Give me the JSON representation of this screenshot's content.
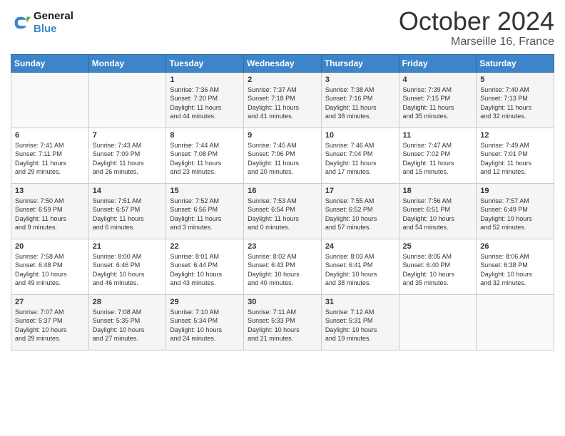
{
  "logo": {
    "text_general": "General",
    "text_blue": "Blue"
  },
  "title": "October 2024",
  "subtitle": "Marseille 16, France",
  "days_header": [
    "Sunday",
    "Monday",
    "Tuesday",
    "Wednesday",
    "Thursday",
    "Friday",
    "Saturday"
  ],
  "weeks": [
    [
      {
        "day": "",
        "info": ""
      },
      {
        "day": "",
        "info": ""
      },
      {
        "day": "1",
        "info": "Sunrise: 7:36 AM\nSunset: 7:20 PM\nDaylight: 11 hours\nand 44 minutes."
      },
      {
        "day": "2",
        "info": "Sunrise: 7:37 AM\nSunset: 7:18 PM\nDaylight: 11 hours\nand 41 minutes."
      },
      {
        "day": "3",
        "info": "Sunrise: 7:38 AM\nSunset: 7:16 PM\nDaylight: 11 hours\nand 38 minutes."
      },
      {
        "day": "4",
        "info": "Sunrise: 7:39 AM\nSunset: 7:15 PM\nDaylight: 11 hours\nand 35 minutes."
      },
      {
        "day": "5",
        "info": "Sunrise: 7:40 AM\nSunset: 7:13 PM\nDaylight: 11 hours\nand 32 minutes."
      }
    ],
    [
      {
        "day": "6",
        "info": "Sunrise: 7:41 AM\nSunset: 7:11 PM\nDaylight: 11 hours\nand 29 minutes."
      },
      {
        "day": "7",
        "info": "Sunrise: 7:43 AM\nSunset: 7:09 PM\nDaylight: 11 hours\nand 26 minutes."
      },
      {
        "day": "8",
        "info": "Sunrise: 7:44 AM\nSunset: 7:08 PM\nDaylight: 11 hours\nand 23 minutes."
      },
      {
        "day": "9",
        "info": "Sunrise: 7:45 AM\nSunset: 7:06 PM\nDaylight: 11 hours\nand 20 minutes."
      },
      {
        "day": "10",
        "info": "Sunrise: 7:46 AM\nSunset: 7:04 PM\nDaylight: 11 hours\nand 17 minutes."
      },
      {
        "day": "11",
        "info": "Sunrise: 7:47 AM\nSunset: 7:02 PM\nDaylight: 11 hours\nand 15 minutes."
      },
      {
        "day": "12",
        "info": "Sunrise: 7:49 AM\nSunset: 7:01 PM\nDaylight: 11 hours\nand 12 minutes."
      }
    ],
    [
      {
        "day": "13",
        "info": "Sunrise: 7:50 AM\nSunset: 6:59 PM\nDaylight: 11 hours\nand 9 minutes."
      },
      {
        "day": "14",
        "info": "Sunrise: 7:51 AM\nSunset: 6:57 PM\nDaylight: 11 hours\nand 6 minutes."
      },
      {
        "day": "15",
        "info": "Sunrise: 7:52 AM\nSunset: 6:56 PM\nDaylight: 11 hours\nand 3 minutes."
      },
      {
        "day": "16",
        "info": "Sunrise: 7:53 AM\nSunset: 6:54 PM\nDaylight: 11 hours\nand 0 minutes."
      },
      {
        "day": "17",
        "info": "Sunrise: 7:55 AM\nSunset: 6:52 PM\nDaylight: 10 hours\nand 57 minutes."
      },
      {
        "day": "18",
        "info": "Sunrise: 7:56 AM\nSunset: 6:51 PM\nDaylight: 10 hours\nand 54 minutes."
      },
      {
        "day": "19",
        "info": "Sunrise: 7:57 AM\nSunset: 6:49 PM\nDaylight: 10 hours\nand 52 minutes."
      }
    ],
    [
      {
        "day": "20",
        "info": "Sunrise: 7:58 AM\nSunset: 6:48 PM\nDaylight: 10 hours\nand 49 minutes."
      },
      {
        "day": "21",
        "info": "Sunrise: 8:00 AM\nSunset: 6:46 PM\nDaylight: 10 hours\nand 46 minutes."
      },
      {
        "day": "22",
        "info": "Sunrise: 8:01 AM\nSunset: 6:44 PM\nDaylight: 10 hours\nand 43 minutes."
      },
      {
        "day": "23",
        "info": "Sunrise: 8:02 AM\nSunset: 6:43 PM\nDaylight: 10 hours\nand 40 minutes."
      },
      {
        "day": "24",
        "info": "Sunrise: 8:03 AM\nSunset: 6:41 PM\nDaylight: 10 hours\nand 38 minutes."
      },
      {
        "day": "25",
        "info": "Sunrise: 8:05 AM\nSunset: 6:40 PM\nDaylight: 10 hours\nand 35 minutes."
      },
      {
        "day": "26",
        "info": "Sunrise: 8:06 AM\nSunset: 6:38 PM\nDaylight: 10 hours\nand 32 minutes."
      }
    ],
    [
      {
        "day": "27",
        "info": "Sunrise: 7:07 AM\nSunset: 5:37 PM\nDaylight: 10 hours\nand 29 minutes."
      },
      {
        "day": "28",
        "info": "Sunrise: 7:08 AM\nSunset: 5:35 PM\nDaylight: 10 hours\nand 27 minutes."
      },
      {
        "day": "29",
        "info": "Sunrise: 7:10 AM\nSunset: 5:34 PM\nDaylight: 10 hours\nand 24 minutes."
      },
      {
        "day": "30",
        "info": "Sunrise: 7:11 AM\nSunset: 5:33 PM\nDaylight: 10 hours\nand 21 minutes."
      },
      {
        "day": "31",
        "info": "Sunrise: 7:12 AM\nSunset: 5:31 PM\nDaylight: 10 hours\nand 19 minutes."
      },
      {
        "day": "",
        "info": ""
      },
      {
        "day": "",
        "info": ""
      }
    ]
  ]
}
